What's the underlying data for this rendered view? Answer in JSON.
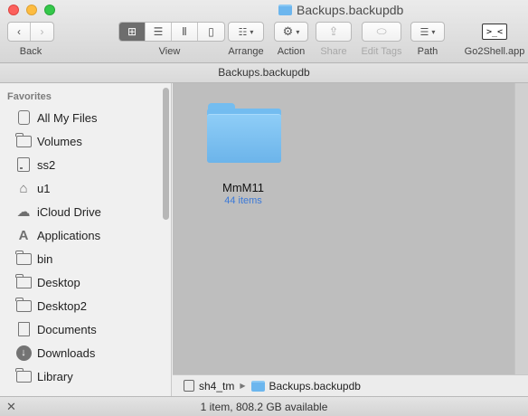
{
  "window": {
    "title": "Backups.backupdb"
  },
  "toolbar": {
    "back_label": "Back",
    "view_label": "View",
    "arrange_label": "Arrange",
    "action_label": "Action",
    "share_label": "Share",
    "edit_tags_label": "Edit Tags",
    "path_label": "Path",
    "go2shell_label": "Go2Shell.app",
    "view_mode_selected": "icon"
  },
  "path_title": "Backups.backupdb",
  "sidebar": {
    "heading": "Favorites",
    "items": [
      {
        "label": "All My Files",
        "icon": "all-files-icon"
      },
      {
        "label": "Volumes",
        "icon": "folder-icon"
      },
      {
        "label": "ss2",
        "icon": "drive-icon"
      },
      {
        "label": "u1",
        "icon": "home-icon"
      },
      {
        "label": "iCloud Drive",
        "icon": "cloud-icon"
      },
      {
        "label": "Applications",
        "icon": "applications-icon"
      },
      {
        "label": "bin",
        "icon": "folder-icon"
      },
      {
        "label": "Desktop",
        "icon": "desktop-icon"
      },
      {
        "label": "Desktop2",
        "icon": "folder-icon"
      },
      {
        "label": "Documents",
        "icon": "document-icon"
      },
      {
        "label": "Downloads",
        "icon": "download-icon"
      },
      {
        "label": "Library",
        "icon": "folder-icon"
      }
    ]
  },
  "content": {
    "items": [
      {
        "name": "MmM11",
        "subtitle": "44 items",
        "icon": "folder-icon"
      }
    ]
  },
  "pathbar": {
    "segments": [
      {
        "label": "sh4_tm",
        "icon": "drive-icon"
      },
      {
        "label": "Backups.backupdb",
        "icon": "folder-icon"
      }
    ]
  },
  "status": {
    "text": "1 item, 808.2 GB available"
  },
  "colors": {
    "folder": "#73bcf0",
    "subtitle": "#3b79d8",
    "content_bg": "#bebebe"
  }
}
